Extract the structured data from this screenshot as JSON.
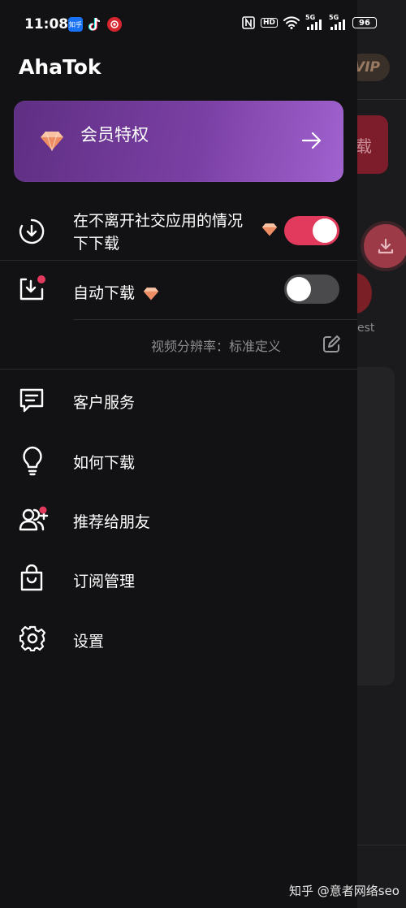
{
  "status_bar": {
    "time": "11:08",
    "notif_zhihu": "知乎",
    "battery": "96",
    "network_label_1": "5G",
    "network_label_2": "5G",
    "hd_label": "HD"
  },
  "background": {
    "vip_badge": "VIP",
    "download_button_char": "载",
    "pinterest_label": "est"
  },
  "drawer": {
    "app_title": "AhaTok",
    "vip_card": {
      "title": "会员特权"
    },
    "toggle_rows": [
      {
        "label_line1": "在不离开社交应用的情况",
        "label_line2": "下下载",
        "premium": true,
        "enabled": true
      },
      {
        "label": "自动下载",
        "premium": true,
        "enabled": false,
        "has_badge": true
      }
    ],
    "resolution_text": "视频分辨率：标准定义",
    "menu_items": [
      {
        "label": "客户服务",
        "icon": "chat-icon"
      },
      {
        "label": "如何下载",
        "icon": "lightbulb-icon"
      },
      {
        "label": "推荐给朋友",
        "icon": "add-friends-icon"
      },
      {
        "label": "订阅管理",
        "icon": "shopping-bag-icon"
      },
      {
        "label": "设置",
        "icon": "gear-icon"
      }
    ]
  },
  "watermark": "知乎 @意者网络seo",
  "colors": {
    "accent_pink": "#e23a5d",
    "vip_purple": "#7a3fa3",
    "gem_orange": "#f4a37a",
    "drawer_bg": "#121214"
  }
}
